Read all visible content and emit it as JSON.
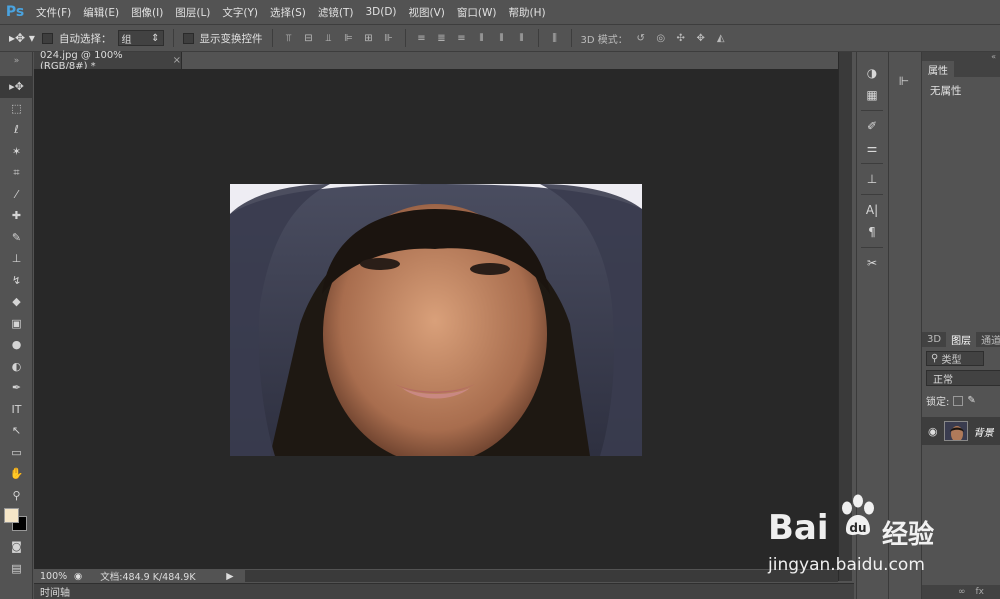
{
  "menubar": {
    "logo": "Ps",
    "items": [
      "文件(F)",
      "编辑(E)",
      "图像(I)",
      "图层(L)",
      "文字(Y)",
      "选择(S)",
      "滤镜(T)",
      "3D(D)",
      "视图(V)",
      "窗口(W)",
      "帮助(H)"
    ]
  },
  "options": {
    "auto_select_label": "自动选择：",
    "auto_select_value": "组",
    "show_transform_label": "显示变换控件",
    "mode3d_label": "3D 模式："
  },
  "document": {
    "tab_title": "024.jpg @ 100%(RGB/8#) *",
    "zoom": "100%",
    "doc_size": "文档:484.9 K/484.9K"
  },
  "timeline": {
    "label": "时间轴"
  },
  "properties": {
    "tab": "属性",
    "empty_text": "无属性"
  },
  "layers": {
    "tabs": [
      "3D",
      "图层",
      "通道"
    ],
    "filter_label": "类型",
    "blend_mode": "正常",
    "lock_label": "锁定:",
    "layer_name": "背景"
  },
  "watermark": {
    "brand": "Bai",
    "brand_suffix": "经验",
    "url": "jingyan.baidu.com"
  },
  "colors": {
    "ui_bg": "#535353",
    "canvas_bg": "#282828",
    "foreground_swatch": "#f5e6c8",
    "background_swatch": "#000000"
  }
}
